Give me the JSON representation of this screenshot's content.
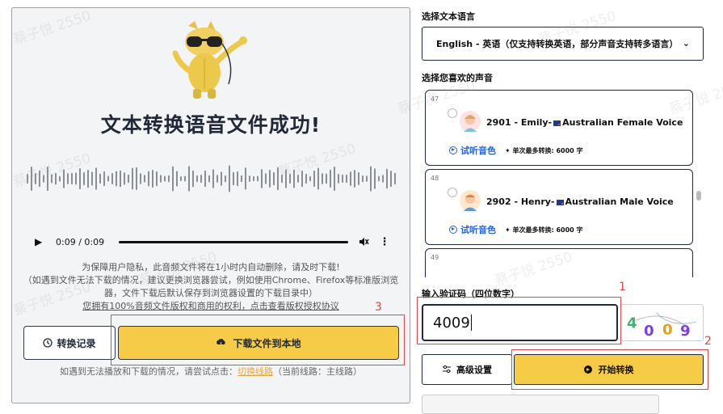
{
  "result": {
    "title": "文本转换语音文件成功!",
    "audio": {
      "time": "0:09 / 0:09"
    },
    "notice_lines": [
      "为保障用户隐私，此音频文件将在1小时内自动删除，请及时下载!",
      "（如遇到文件无法下载的情况，建议更换浏览器尝试，例如使用Chrome、Firefox等标准版浏览",
      "器，文件下载后默认保存到浏览器设置的下载目录中）",
      "您拥有100%音频文件版权和商用的权利，点击查看版权授权协议"
    ],
    "history_button": "转换记录",
    "download_button": "下载文件到本地",
    "hint_prefix": "如遇到无法播放和下载的情况，请尝试点击：",
    "hint_link": "切换线路",
    "hint_suffix": "（当前线路：主线路）"
  },
  "settings": {
    "language_label": "选择文本语言",
    "language_value": "English - 英语（仅支持转换英语，部分声音支持转多语言）",
    "voice_label": "选择您喜欢的声音",
    "voices": [
      {
        "index": "47",
        "name": "2901 - Emily-",
        "suffix": "Australian Female Voice",
        "preview": "试听音色",
        "limit": "单次最多转换: 6000 字"
      },
      {
        "index": "48",
        "name": "2902 - Henry-",
        "suffix": "Australian Male Voice",
        "preview": "试听音色",
        "limit": "单次最多转换: 6000 字"
      },
      {
        "index": "49"
      }
    ],
    "captcha_label": "输入验证码（四位数字）",
    "captcha_value": "4009",
    "captcha_digits": [
      "4",
      "0",
      "0",
      "9"
    ],
    "advanced_button": "高级设置",
    "start_button": "开始转换"
  },
  "annotations": [
    "1",
    "2",
    "3"
  ],
  "watermark": "蔡子悦 2550",
  "colors": {
    "accent_yellow": "#f6cb45",
    "annotation_red": "#e0484a",
    "link_blue": "#2563eb",
    "link_orange": "#e7a63a"
  }
}
